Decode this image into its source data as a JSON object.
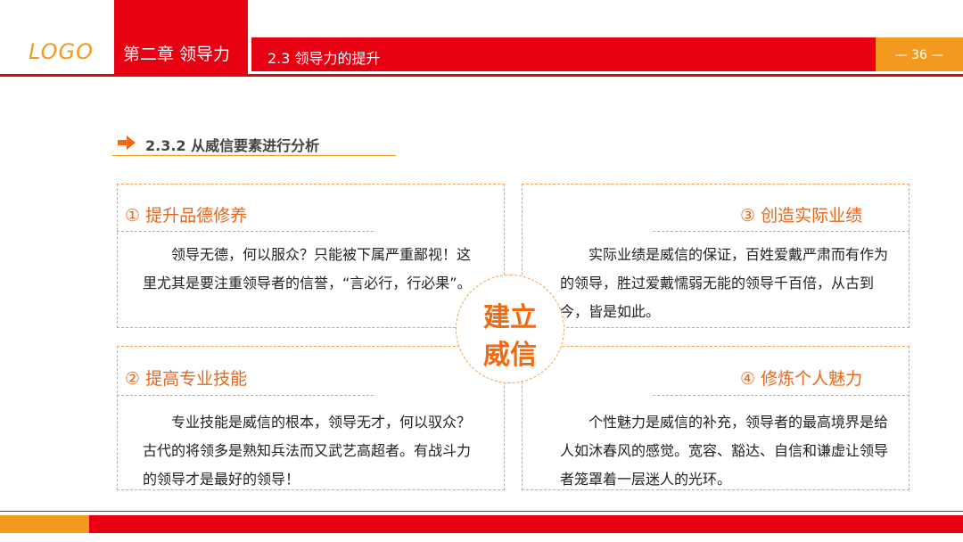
{
  "header": {
    "logo": "LOGO",
    "chapter": "第二章 领导力",
    "section": "2.3 领导力的提升",
    "page": "— 36 —"
  },
  "subsection": {
    "title": "2.3.2 从威信要素进行分析"
  },
  "cards": [
    {
      "title": "① 提升品德修养",
      "body": "领导无德，何以服众？只能被下属严重鄙视！这里尤其是要注重领导者的信誉，“言必行，行必果”。"
    },
    {
      "title": "③ 创造实际业绩",
      "body": "实际业绩是威信的保证，百姓爱戴严肃而有作为的领导，胜过爱戴懦弱无能的领导千百倍，从古到今，皆是如此。"
    },
    {
      "title": "② 提高专业技能",
      "body": "专业技能是威信的根本，领导无才，何以驭众？古代的将领多是熟知兵法而又武艺高超者。有战斗力的领导才是最好的领导！"
    },
    {
      "title": "④ 修炼个人魅力",
      "body": "个性魅力是威信的补充，领导者的最高境界是给人如沐春风的感觉。宽容、豁达、自信和谦虚让领导者笼罩着一层迷人的光环。"
    }
  ],
  "center": {
    "line1": "建立",
    "line2": "威信"
  },
  "colors": {
    "brand_red": "#e60012",
    "accent_orange": "#f39a1e",
    "title_orange": "#e8661c"
  }
}
